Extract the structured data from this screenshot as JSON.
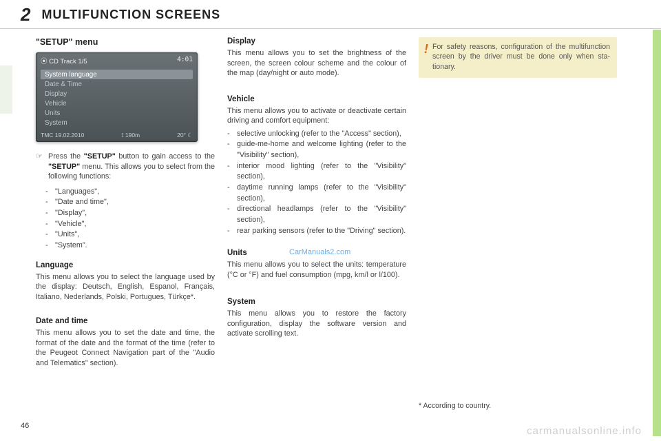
{
  "header": {
    "chapter_num": "2",
    "title": "MULTIFUNCTION SCREENS"
  },
  "page_num": "46",
  "watermarks": {
    "footer": "carmanualsonline.info",
    "inline": "CarManuals2.com"
  },
  "col1": {
    "setup_title": "\"SETUP\" menu",
    "screenshot": {
      "top_left": "⦿ CD   Track 1/5",
      "top_right": "4:01",
      "items": [
        "System language",
        "Date & Time",
        "Display",
        "Vehicle",
        "Units",
        "System"
      ],
      "bot_left": "TMC   19.02.2010",
      "bot_mid": "⟟ 190m",
      "bot_right": "20° ☾"
    },
    "intro_pre": "Press the ",
    "intro_b1": "\"SETUP\"",
    "intro_mid": " button to gain access to the ",
    "intro_b2": "\"SETUP\"",
    "intro_post": " menu. This allows you to select from the follow­ing functions:",
    "func_list": [
      "\"Languages\",",
      "\"Date and time\",",
      "\"Display\",",
      "\"Vehicle\",",
      "\"Units\",",
      "\"System\"."
    ],
    "language_title": "Language",
    "language_body": "This menu allows you to select the lan­guage used by the display: Deutsch, English, Espanol, Français, Italiano, Nederlands, Polski, Portugues, Türkçe*.",
    "date_title": "Date and time",
    "date_body": "This menu allows you to set the date and time, the format of the date and the format of the time (refer to the Peugeot Connect Navigation part of the \"Audio and Telematics\" section)."
  },
  "col2": {
    "display_title": "Display",
    "display_body": "This menu allows you to set the bright­ness of the screen, the screen colour scheme and the colour of the map (day/night or auto mode).",
    "vehicle_title": "Vehicle",
    "vehicle_intro": "This menu allows you to activate or deactivate certain driving and comfort equipment:",
    "vehicle_items": [
      "selective unlocking (refer to the \"Access\" section),",
      "guide-me-home and welcome light­ing (refer to the \"Visibility\" section),",
      "interior mood lighting (refer to the \"Visibility\" section),",
      "daytime running lamps (refer to the \"Visibility\" section),",
      "directional headlamps (refer to the \"Visibility\" section),",
      "rear parking sensors (refer to the \"Driving\" section)."
    ],
    "units_title": "Units",
    "units_body": "This menu allows you to select the units: temperature (°C or °F) and fuel consumption (mpg, km/l or l/100).",
    "system_title": "System",
    "system_body": "This menu allows you to restore the fac­tory configuration, display the software version and activate scrolling text."
  },
  "col3": {
    "warning": "For safety reasons, configuration of the multifunction screen by the driver must be done only when sta­tionary.",
    "footnote": "* According to country."
  }
}
